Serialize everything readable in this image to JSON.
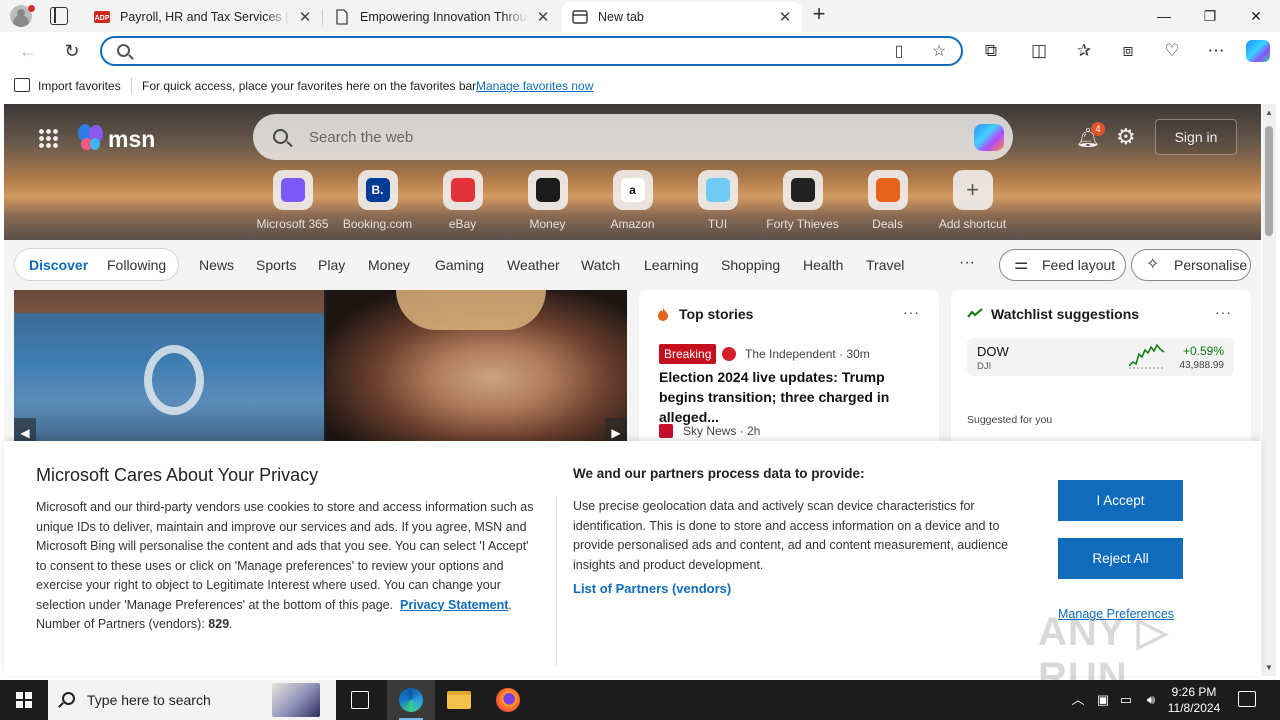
{
  "browser": {
    "tabs": [
      {
        "title": "Payroll, HR and Tax Services | ADP",
        "favicon": "adp-icon"
      },
      {
        "title": "Empowering Innovation Through",
        "favicon": "page-icon"
      },
      {
        "title": "New tab",
        "favicon": "newtab-icon"
      }
    ],
    "address": {
      "value": "",
      "placeholder": ""
    },
    "favorites_bar": {
      "import_label": "Import favorites",
      "hint": "For quick access, place your favorites here on the favorites bar.",
      "manage_link": "Manage favorites now"
    }
  },
  "msn": {
    "logo_text": "msn",
    "search_placeholder": "Search the web",
    "notifications_count": "4",
    "signin_label": "Sign in",
    "shortcuts": [
      {
        "label": "Microsoft 365",
        "icon": "microsoft365-icon",
        "color": "#7a5af8"
      },
      {
        "label": "Booking.com",
        "icon": "booking-icon",
        "color": "#003b95",
        "glyph": "B."
      },
      {
        "label": "eBay",
        "icon": "ebay-icon",
        "color": "#e53238"
      },
      {
        "label": "Money",
        "icon": "money-icon",
        "color": "#1b1b1b"
      },
      {
        "label": "Amazon",
        "icon": "amazon-icon",
        "color": "#ffffff",
        "glyph": "a"
      },
      {
        "label": "TUI",
        "icon": "tui-icon",
        "color": "#70cbf4"
      },
      {
        "label": "Forty Thieves",
        "icon": "forty-thieves-icon",
        "color": "#222222"
      },
      {
        "label": "Deals",
        "icon": "deals-icon",
        "color": "#e8631a"
      },
      {
        "label": "Add shortcut",
        "icon": "plus-icon",
        "color": "#555555",
        "glyph": "+"
      }
    ],
    "feed_tabs": {
      "discover": "Discover",
      "following": "Following"
    },
    "categories": [
      "News",
      "Sports",
      "Play",
      "Money",
      "Gaming",
      "Weather",
      "Watch",
      "Learning",
      "Shopping",
      "Health",
      "Travel"
    ],
    "feed_layout_label": "Feed layout",
    "personalise_label": "Personalise",
    "top_stories": {
      "title": "Top stories",
      "badge": "Breaking",
      "source1": "The Independent · 30m",
      "headline": "Election 2024 live updates: Trump begins transition; three charged in alleged...",
      "source2": "Sky News · 2h"
    },
    "watchlist": {
      "title": "Watchlist suggestions",
      "stock": {
        "symbol": "DOW",
        "sub": "DJI",
        "change": "+0.59%",
        "price": "43,988.99"
      },
      "suggested_label": "Suggested for you"
    }
  },
  "privacy": {
    "title": "Microsoft Cares About Your Privacy",
    "body": "Microsoft and our third-party vendors use cookies to store and access information such as unique IDs to deliver, maintain and improve our services and ads. If you agree, MSN and Microsoft Bing will personalise the content and ads that you see. You can select 'I Accept' to consent to these uses or click on 'Manage preferences' to review your options and exercise your right to object to Legitimate Interest where used.  You can change your selection under 'Manage Preferences' at the bottom of this page.",
    "statement_link": "Privacy Statement",
    "partners_label": "Number of Partners (vendors):",
    "partners_count": "829",
    "sub_title": "We and our partners process data to provide:",
    "body2": "Use precise geolocation data and actively scan device characteristics for identification. This is done to store and access information on a device and to provide personalised ads and content, ad and content measurement, audience insights and product development.",
    "partners_link": "List of Partners (vendors)",
    "accept_label": "I Accept",
    "reject_label": "Reject All",
    "manage_label": "Manage Preferences"
  },
  "watermark": "ANY RUN",
  "taskbar": {
    "search_placeholder": "Type here to search",
    "time": "9:26 PM",
    "date": "11/8/2024"
  }
}
